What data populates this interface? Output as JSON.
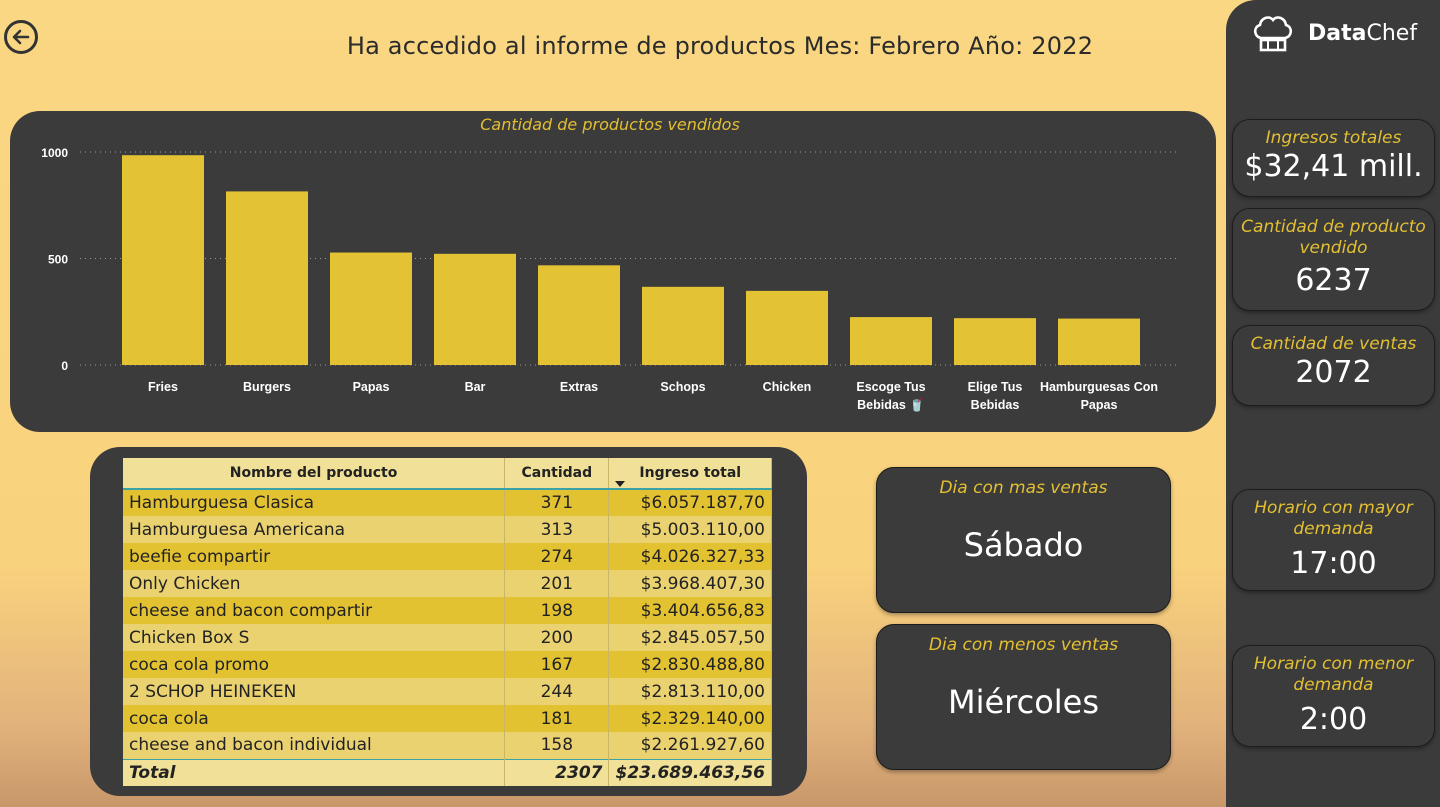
{
  "header": {
    "title": "Ha accedido al informe de productos  Mes: Febrero Año: 2022"
  },
  "brand": {
    "name_bold": "Data",
    "name_rest": "Chef"
  },
  "chart_data": {
    "type": "bar",
    "title": "Cantidad de productos vendidos",
    "categories": [
      "Fries",
      "Burgers",
      "Papas",
      "Bar",
      "Extras",
      "Schops",
      "Chicken",
      "Escoge Tus Bebidas 🥤",
      "Elige Tus Bebidas",
      "Hamburguesas Con Papas"
    ],
    "values": [
      985,
      815,
      528,
      522,
      468,
      367,
      348,
      225,
      220,
      218
    ],
    "ylim": [
      0,
      1000
    ],
    "yticks": [
      0,
      500,
      1000
    ],
    "grid": true,
    "color": "#e3c233"
  },
  "table": {
    "headers": [
      "Nombre del producto",
      "Cantidad",
      "Ingreso total"
    ],
    "rows": [
      [
        "Hamburguesa Clasica",
        "371",
        "$6.057.187,70"
      ],
      [
        "Hamburguesa Americana",
        "313",
        "$5.003.110,00"
      ],
      [
        "beefie compartir",
        "274",
        "$4.026.327,33"
      ],
      [
        "Only Chicken",
        "201",
        "$3.968.407,30"
      ],
      [
        "cheese and bacon compartir",
        "198",
        "$3.404.656,83"
      ],
      [
        "Chicken Box S",
        "200",
        "$2.845.057,50"
      ],
      [
        "coca cola promo",
        "167",
        "$2.830.488,80"
      ],
      [
        "2 SCHOP HEINEKEN",
        "244",
        "$2.813.110,00"
      ],
      [
        "coca cola",
        "181",
        "$2.329.140,00"
      ],
      [
        "cheese and bacon individual",
        "158",
        "$2.261.927,60"
      ]
    ],
    "total": [
      "Total",
      "2307",
      "$23.689.463,56"
    ]
  },
  "days": {
    "max_label": "Dia con mas ventas",
    "max_value": "Sábado",
    "min_label": "Dia con menos ventas",
    "min_value": "Miércoles"
  },
  "kpis": {
    "ingresos_label": "Ingresos totales",
    "ingresos_value": "$32,41 mill.",
    "cantidad_label": "Cantidad de producto vendido",
    "cantidad_value": "6237",
    "ventas_label": "Cantidad de ventas",
    "ventas_value": "2072",
    "mayor_label": "Horario con mayor demanda",
    "mayor_value": "17:00",
    "menor_label": "Horario con menor demanda",
    "menor_value": "2:00"
  },
  "colors": {
    "accent": "#e3bf32",
    "panel": "#3b3b3b",
    "background": "#fad783"
  }
}
